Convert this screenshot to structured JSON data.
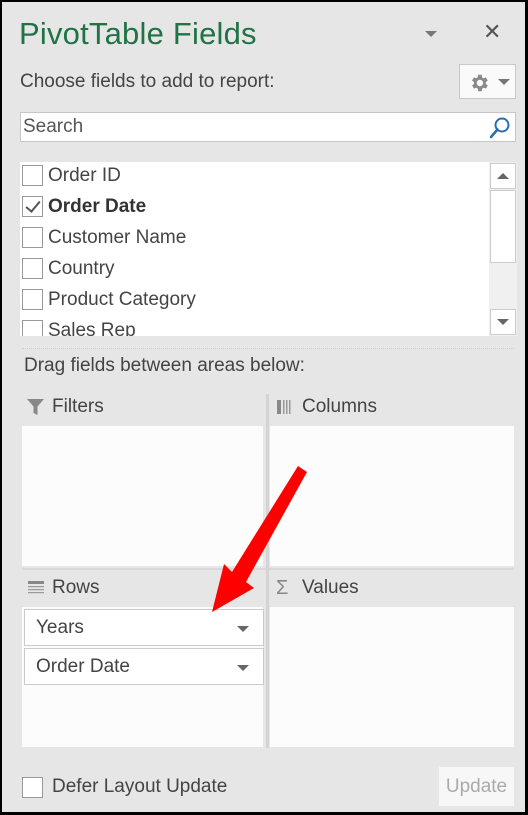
{
  "panel": {
    "title": "PivotTable Fields",
    "choose_label": "Choose fields to add to report:",
    "title_colour": "#217346"
  },
  "search": {
    "placeholder": "Search"
  },
  "fields": [
    {
      "label": "Order ID",
      "checked": false
    },
    {
      "label": "Order Date",
      "checked": true
    },
    {
      "label": "Customer Name",
      "checked": false
    },
    {
      "label": "Country",
      "checked": false
    },
    {
      "label": "Product Category",
      "checked": false
    },
    {
      "label": "Sales Rep",
      "checked": false
    }
  ],
  "areas": {
    "drag_label": "Drag fields between areas below:",
    "filters": {
      "label": "Filters",
      "items": []
    },
    "columns": {
      "label": "Columns",
      "items": []
    },
    "rows": {
      "label": "Rows",
      "items": [
        {
          "label": "Years"
        },
        {
          "label": "Order Date"
        }
      ]
    },
    "values": {
      "label": "Values",
      "items": []
    }
  },
  "footer": {
    "defer_label": "Defer Layout Update",
    "defer_checked": false,
    "update_label": "Update"
  },
  "annotation": {
    "arrow_colour": "#ff0000",
    "points_to": "Years"
  }
}
